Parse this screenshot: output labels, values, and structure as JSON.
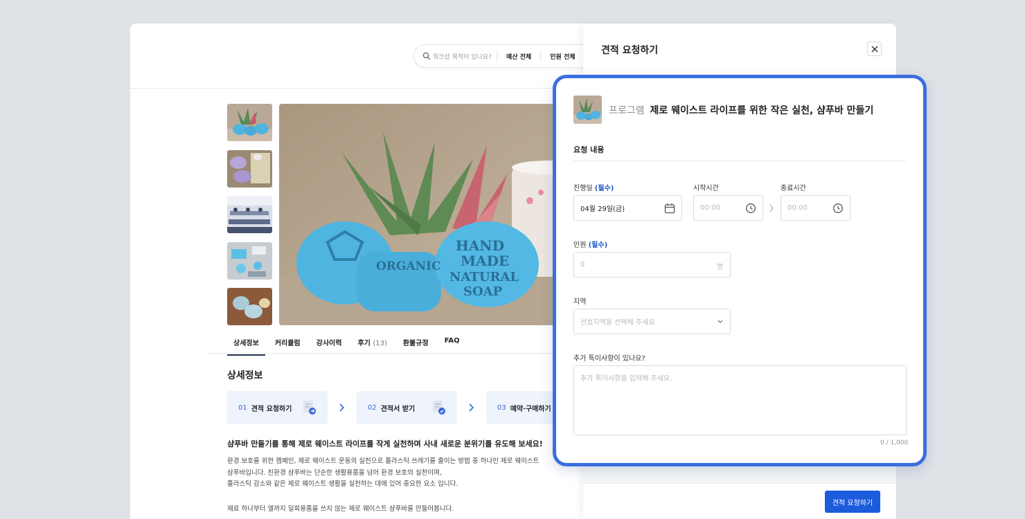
{
  "search": {
    "placeholder": "워크샵 목적이 있나요?",
    "filter_budget": "예산 전체",
    "filter_people": "인원 전체"
  },
  "tabs": [
    {
      "label": "상세정보"
    },
    {
      "label": "커리큘럼"
    },
    {
      "label": "강사이력"
    },
    {
      "label": "후기",
      "count": "(13)"
    },
    {
      "label": "환불규정"
    },
    {
      "label": "FAQ"
    }
  ],
  "detail": {
    "section_title": "상세정보",
    "steps": [
      {
        "num": "01",
        "label": "견적 요청하기"
      },
      {
        "num": "02",
        "label": "견적서 받기"
      },
      {
        "num": "03",
        "label": "예약·구매하기"
      }
    ],
    "headline": "샴푸바 만들기를 통해 제로 웨이스트 라이프를 작게 실천하며 사내 새로운 분위기를 유도해 보세요!",
    "paragraph": [
      "환경 보호를 위한 캠페인, 제로 웨이스트 운동의 실천으로 플라스틱 쓰레기를 줄이는 방법 중 하나인 제로 웨이스트",
      "샴푸바입니다. 친환경 샴푸바는 단순한 생활용품을 넘어 환경 보호의 실천이며,",
      "플라스틱 감소와 같은 제로 웨이스트 생활을 실천하는 데에 있어 중요한 요소 입니다."
    ],
    "paragraph2": "재료 하나부터 엘까지 일회용품을 쓰지 않는 제로 웨이스트 샴푸바를 만들어봅니다."
  },
  "drawer": {
    "title": "견적 요청하기",
    "submit_label": "견적 요청하기"
  },
  "form": {
    "program_label": "프로그램",
    "program_name": "제로 웨이스트 라이프를 위한 작은 실천, 샴푸바 만들기",
    "section_title": "요청 내용",
    "date_label": "진행일",
    "required_mark": "(필수)",
    "date_value": "04월 29일(금)",
    "start_label": "시작시간",
    "start_placeholder": "00:00",
    "end_label": "종료시간",
    "end_placeholder": "00:00",
    "people_label": "인원",
    "people_placeholder": "0",
    "people_suffix": "명",
    "region_label": "지역",
    "region_placeholder": "선호지역을 선택해 주세요",
    "notes_label": "추가 특이사항이 있나요?",
    "notes_placeholder": "추가 특이사항을 입력해 주세요.",
    "notes_counter": "0 / 1,000"
  },
  "colors": {
    "accent": "#1c5bdc",
    "highlight_border": "#3b6ee0",
    "step_bg": "#eef3fc",
    "soap_blue": "#4fb4e0"
  }
}
